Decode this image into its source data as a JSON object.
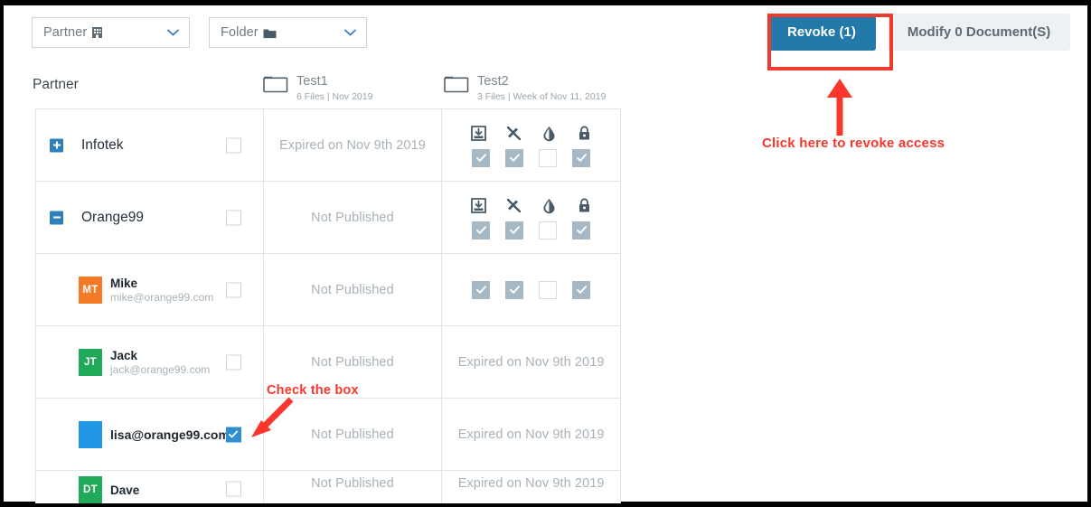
{
  "filters": [
    {
      "label": "Partner",
      "icon": "building-icon",
      "caret": "chevron-down-icon"
    },
    {
      "label": "Folder",
      "icon": "folder-icon",
      "caret": "chevron-down-icon"
    }
  ],
  "table": {
    "partner_header": "Partner",
    "folders": [
      {
        "name": "Test1",
        "meta": "6 Files | Nov 2019"
      },
      {
        "name": "Test2",
        "meta": "3 Files | Week of Nov 11, 2019"
      }
    ],
    "permission_icons": [
      "download-icon",
      "no-edit-pencil-icon",
      "watermark-droplet-icon",
      "lock-icon"
    ],
    "rows": [
      {
        "type": "org",
        "toggle": "plus",
        "name": "Infotek",
        "checked": false,
        "test1": {
          "status": "Expired on Nov 9th 2019",
          "show_perms": false
        },
        "test2": {
          "show_perms": true,
          "perms": [
            true,
            true,
            false,
            true
          ]
        }
      },
      {
        "type": "org",
        "toggle": "minus",
        "name": "Orange99",
        "checked": false,
        "test1": {
          "status": "Not Published",
          "show_perms": false
        },
        "test2": {
          "show_perms": true,
          "perms": [
            true,
            true,
            false,
            true
          ]
        }
      },
      {
        "type": "user",
        "avatar_initials": "MT",
        "avatar_color": "#f47a28",
        "name": "Mike",
        "email": "mike@orange99.com",
        "checked": false,
        "test1": {
          "status": "Not Published",
          "show_perms": false
        },
        "test2": {
          "show_perms": true,
          "perms": [
            true,
            true,
            false,
            true
          ],
          "icons_hidden": true
        }
      },
      {
        "type": "user",
        "avatar_initials": "JT",
        "avatar_color": "#21a95a",
        "name": "Jack",
        "email": "jack@orange99.com",
        "checked": false,
        "test1": {
          "status": "Not Published",
          "show_perms": false
        },
        "test2": {
          "status": "Expired on Nov 9th 2019",
          "show_perms": false
        }
      },
      {
        "type": "user-single",
        "avatar_initials": "",
        "avatar_color": "#2196e3",
        "name": "lisa@orange99.com",
        "checked": true,
        "test1": {
          "status": "Not Published",
          "show_perms": false
        },
        "test2": {
          "status": "Expired on Nov 9th 2019",
          "show_perms": false
        }
      },
      {
        "type": "user",
        "avatar_initials": "DT",
        "avatar_color": "#21a95a",
        "name": "Dave",
        "email": "",
        "checked": false,
        "test1": {
          "status": "Not Published",
          "show_perms": false
        },
        "test2": {
          "status": "Expired on Nov 9th 2019",
          "show_perms": false
        }
      }
    ]
  },
  "actions": {
    "revoke_label": "Revoke (1)",
    "modify_label": "Modify 0 Document(S)"
  },
  "annotations": {
    "revoke_hint": "Click here to revoke access",
    "checkbox_hint": "Check the box",
    "highlight_color": "#ef3b2d"
  }
}
